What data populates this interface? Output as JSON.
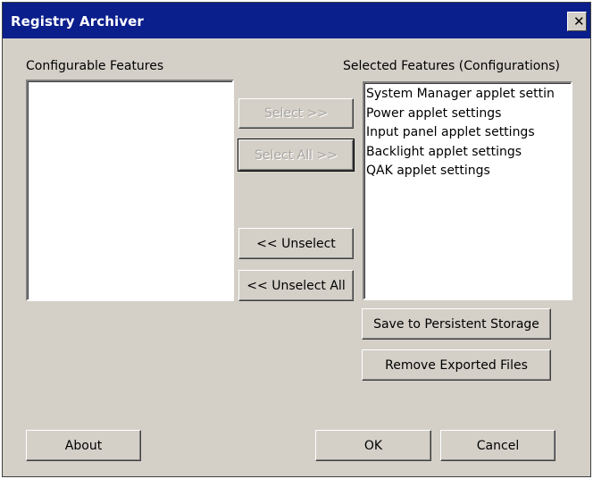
{
  "window": {
    "title": "Registry Archiver",
    "close_glyph": "✕"
  },
  "configurable": {
    "label": "Configurable Features",
    "items": []
  },
  "selected": {
    "label": "Selected Features (Configurations)",
    "items": [
      "System Manager applet settin",
      "Power applet settings",
      "Input panel applet settings",
      "Backlight applet settings",
      "QAK applet settings"
    ]
  },
  "buttons": {
    "select": "Select >>",
    "select_all": "Select All >>",
    "unselect": "<< Unselect",
    "unselect_all": "<< Unselect All",
    "save": "Save to Persistent Storage",
    "remove": "Remove Exported Files",
    "about": "About",
    "ok": "OK",
    "cancel": "Cancel"
  },
  "colors": {
    "titlebar": "#0a1e8c",
    "face": "#d4d0c8"
  }
}
